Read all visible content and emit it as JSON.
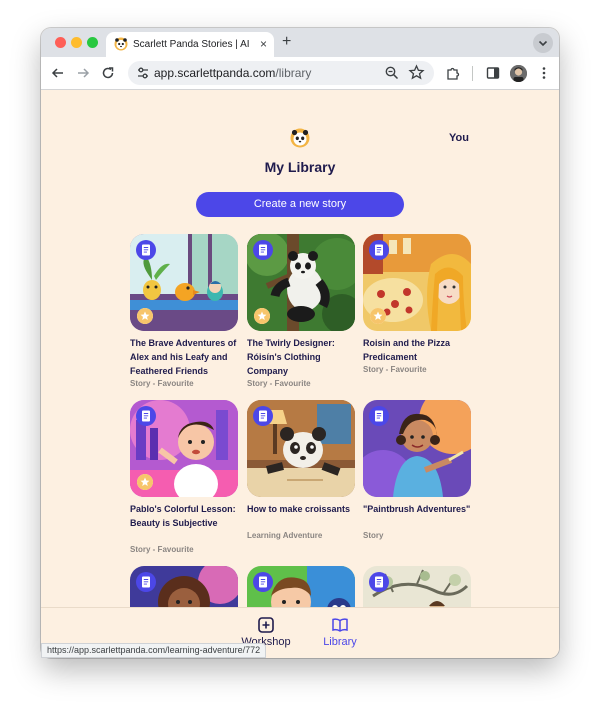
{
  "browser": {
    "tab_title": "Scarlett Panda Stories | AI Ge",
    "tab_close": "×",
    "new_tab": "+",
    "url_host": "app.scarlettpanda.com",
    "url_path": "/library",
    "status_url": "https://app.scarlettpanda.com/learning-adventure/772"
  },
  "header": {
    "you_label": "You",
    "page_title": "My Library",
    "create_button": "Create a new story"
  },
  "stories": [
    {
      "title": "The Brave Adventures of Alex and his Leafy and Feathered Friends",
      "meta": "Story - Favourite",
      "favourite": true
    },
    {
      "title": "The Twirly Designer: Róisín's Clothing Company",
      "meta": "Story - Favourite",
      "favourite": true
    },
    {
      "title": "Roisin and the Pizza Predicament",
      "meta": "Story - Favourite",
      "favourite": true
    },
    {
      "title": "Pablo's Colorful Lesson: Beauty is Subjective",
      "meta": "Story - Favourite",
      "favourite": true
    },
    {
      "title": "How to make croissants",
      "meta": "Learning Adventure",
      "favourite": false
    },
    {
      "title": "\"Paintbrush Adventures\"",
      "meta": "Story",
      "favourite": false
    },
    {
      "title": "",
      "meta": "",
      "favourite": false
    },
    {
      "title": "",
      "meta": "",
      "favourite": false
    },
    {
      "title": "",
      "meta": "",
      "favourite": false
    }
  ],
  "bottom_nav": {
    "workshop_label": "Workshop",
    "library_label": "Library"
  },
  "icons": {
    "back": "arrow-left-icon",
    "forward": "arrow-right-icon",
    "reload": "reload-icon",
    "site_settings": "tune-icon",
    "zoom": "zoom-icon",
    "bookmark": "star-icon",
    "extensions": "puzzle-icon",
    "side_panel": "side-panel-icon",
    "menu": "kebab-menu-icon",
    "document": "document-icon",
    "favourite": "star-badge-icon"
  },
  "colors": {
    "accent": "#4c47e8",
    "page_bg": "#fdf0e1",
    "heading": "#1f1b4d",
    "meta": "#8a8582"
  }
}
